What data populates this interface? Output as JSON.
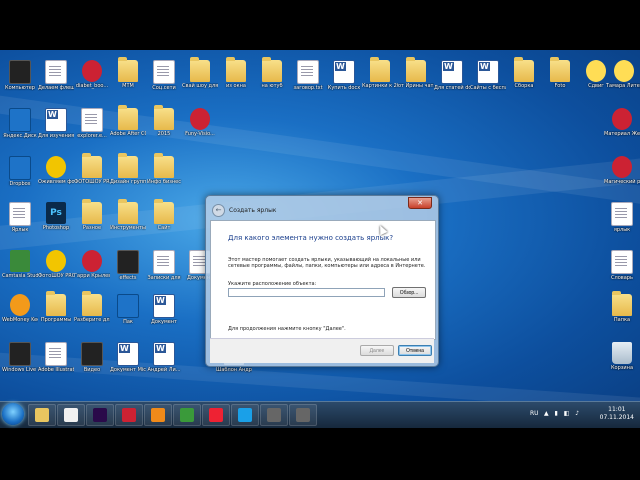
{
  "desktop": {
    "icons": [
      {
        "label": "Компьютер",
        "type": "dark"
      },
      {
        "label": "Делаем флеш плеер",
        "type": "doc"
      },
      {
        "label": "diabet_boo...",
        "type": "red"
      },
      {
        "label": "МТМ",
        "type": "folder"
      },
      {
        "label": "Соц.сети",
        "type": "doc"
      },
      {
        "label": "Свай шоу для гостей",
        "type": "folder"
      },
      {
        "label": "из окна",
        "type": "folder"
      },
      {
        "label": "на ютуб",
        "type": "folder"
      },
      {
        "label": "заговор.txt",
        "type": "doc"
      },
      {
        "label": "Купить docx",
        "type": "word"
      },
      {
        "label": "Картинки к 2015 году",
        "type": "folder"
      },
      {
        "label": "от Ирины чаташевой",
        "type": "folder"
      },
      {
        "label": "Для статей docx",
        "type": "word"
      },
      {
        "label": "Сайты с бесплатно...",
        "type": "word"
      },
      {
        "label": "Сборка",
        "type": "folder"
      },
      {
        "label": "Foto",
        "type": "folder"
      },
      {
        "label": "Сдвиг",
        "type": "music"
      },
      {
        "label": "Тамара Литер 2014",
        "type": "music"
      },
      {
        "label": "Яндекс.Диск",
        "type": "blue"
      },
      {
        "label": "Для изучения...",
        "type": "word"
      },
      {
        "label": "explorer.e...",
        "type": "doc"
      },
      {
        "label": "Adobe After CC 2014 2...",
        "type": "folder"
      },
      {
        "label": "2015",
        "type": "folder"
      },
      {
        "label": "Funy-Visio...",
        "type": "red"
      },
      {
        "label": "Материал Желаем я...",
        "type": "red"
      },
      {
        "label": "Dropbox",
        "type": "blue"
      },
      {
        "label": "Оживляем фото",
        "type": "yellow"
      },
      {
        "label": "ФОТОШОУ PRO",
        "type": "folder"
      },
      {
        "label": "Дизайн группы",
        "type": "folder"
      },
      {
        "label": "Инфо бизнес",
        "type": "folder"
      },
      {
        "label": "Магический ритуал",
        "type": "red"
      },
      {
        "label": "Ярлык",
        "type": "doc"
      },
      {
        "label": "Photoshop",
        "type": "ps"
      },
      {
        "label": "Разное",
        "type": "folder"
      },
      {
        "label": "Инструменты",
        "type": "folder"
      },
      {
        "label": "Сайт",
        "type": "folder"
      },
      {
        "label": "ярлык",
        "type": "doc"
      },
      {
        "label": "Camtasia Studio 8",
        "type": "green"
      },
      {
        "label": "ФотоШОУ PRO",
        "type": "yellow"
      },
      {
        "label": "Гарри Крылевской",
        "type": "red"
      },
      {
        "label": "effects",
        "type": "dark"
      },
      {
        "label": "Записки для",
        "type": "doc"
      },
      {
        "label": "Документ",
        "type": "doc"
      },
      {
        "label": "Словарь",
        "type": "doc"
      },
      {
        "label": "WebMoney Keeper",
        "type": "orange"
      },
      {
        "label": "Программы",
        "type": "folder"
      },
      {
        "label": "Разберите для",
        "type": "folder"
      },
      {
        "label": "Пак",
        "type": "blue"
      },
      {
        "label": "Документ",
        "type": "word"
      },
      {
        "label": "Папка",
        "type": "folder"
      },
      {
        "label": "Windows Live Writer",
        "type": "dark"
      },
      {
        "label": "Adobe Illustrator",
        "type": "doc"
      },
      {
        "label": "Видео",
        "type": "dark"
      },
      {
        "label": "Документ Microsoft",
        "type": "word"
      },
      {
        "label": "Андрей Ли...",
        "type": "word"
      },
      {
        "label": "Шаблон Андрей Ли...",
        "type": "word"
      },
      {
        "label": "Корзина",
        "type": "recycle"
      }
    ]
  },
  "dialog": {
    "title": "Создать ярлык",
    "close_label": "✕",
    "heading": "Для какого элемента нужно создать ярлык?",
    "description": "Этот мастер помогает создать ярлыки, указывающий на локальные или сетевые программы, файлы, папки, компьютеры или адреса в Интернете.",
    "field_label": "Укажите расположение объекта:",
    "field_value": "",
    "browse_label": "Обзор...",
    "hint": "Для продолжения нажмите кнопку \"Далее\".",
    "next_label": "Далее",
    "cancel_label": "Отмена"
  },
  "taskbar": {
    "apps": [
      {
        "name": "explorer",
        "color": "#e9c660"
      },
      {
        "name": "media-player",
        "color": "#f0f0f0"
      },
      {
        "name": "after-effects",
        "color": "#2a0a4a"
      },
      {
        "name": "filezilla",
        "color": "#c23"
      },
      {
        "name": "firefox",
        "color": "#f08a1a"
      },
      {
        "name": "chrome",
        "color": "#3a9a3a"
      },
      {
        "name": "yandex",
        "color": "#e23"
      },
      {
        "name": "skype",
        "color": "#1aa0e8"
      },
      {
        "name": "app-window-1",
        "color": "#666"
      },
      {
        "name": "app-window-2",
        "color": "#666"
      }
    ],
    "lang": "RU",
    "time": "11:01",
    "date": "07.11.2014"
  }
}
